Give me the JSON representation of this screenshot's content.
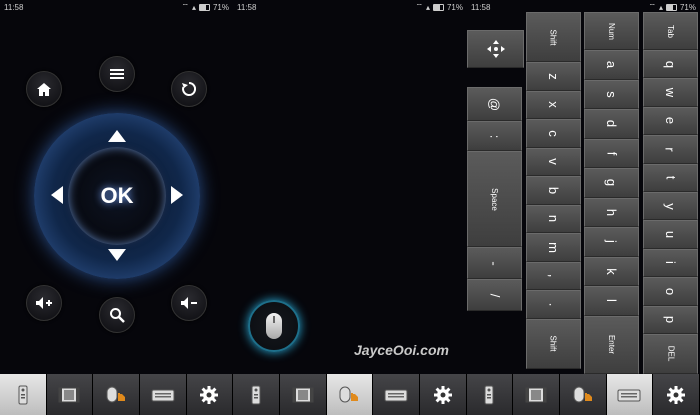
{
  "status": {
    "time": "11:58",
    "battery": "71%"
  },
  "remote": {
    "ok_label": "OK",
    "buttons": [
      "home",
      "menu",
      "back",
      "volume-up",
      "search",
      "volume-down"
    ]
  },
  "watermark": "JayceOoi.com",
  "keyboard": {
    "col_a": {
      "move": "move-icon",
      "at": "@",
      "colon": ":",
      "space": "Space",
      "dash": "-",
      "slash": "/"
    },
    "col_b": {
      "shift": "Shift",
      "keys": [
        "z",
        "x",
        "c",
        "v",
        "b",
        "n",
        "m",
        ",",
        "."
      ],
      "shift2": "Shift"
    },
    "col_c": {
      "num": "Num",
      "keys": [
        "a",
        "s",
        "d",
        "f",
        "g",
        "h",
        "j",
        "k",
        "l"
      ],
      "enter": "Enter"
    },
    "col_d": {
      "tab": "Tab",
      "keys": [
        "q",
        "w",
        "e",
        "r",
        "t",
        "y",
        "u",
        "i",
        "o",
        "p"
      ],
      "del": "DEL"
    }
  },
  "taskbar": [
    {
      "icon": "remote-icon",
      "active": true
    },
    {
      "icon": "film-icon",
      "active": false
    },
    {
      "icon": "mouse-touch-icon",
      "active": false
    },
    {
      "icon": "keyboard-icon",
      "active": false
    },
    {
      "icon": "gear-icon",
      "active": false
    },
    {
      "icon": "remote-icon",
      "active": false
    },
    {
      "icon": "film-icon",
      "active": false
    },
    {
      "icon": "mouse-touch-icon",
      "active": true
    },
    {
      "icon": "keyboard-icon",
      "active": false
    },
    {
      "icon": "gear-icon",
      "active": false
    },
    {
      "icon": "remote-icon",
      "active": false
    },
    {
      "icon": "film-icon",
      "active": false
    },
    {
      "icon": "mouse-touch-icon",
      "active": false
    },
    {
      "icon": "keyboard-icon",
      "active": true
    },
    {
      "icon": "gear-icon",
      "active": false
    }
  ]
}
